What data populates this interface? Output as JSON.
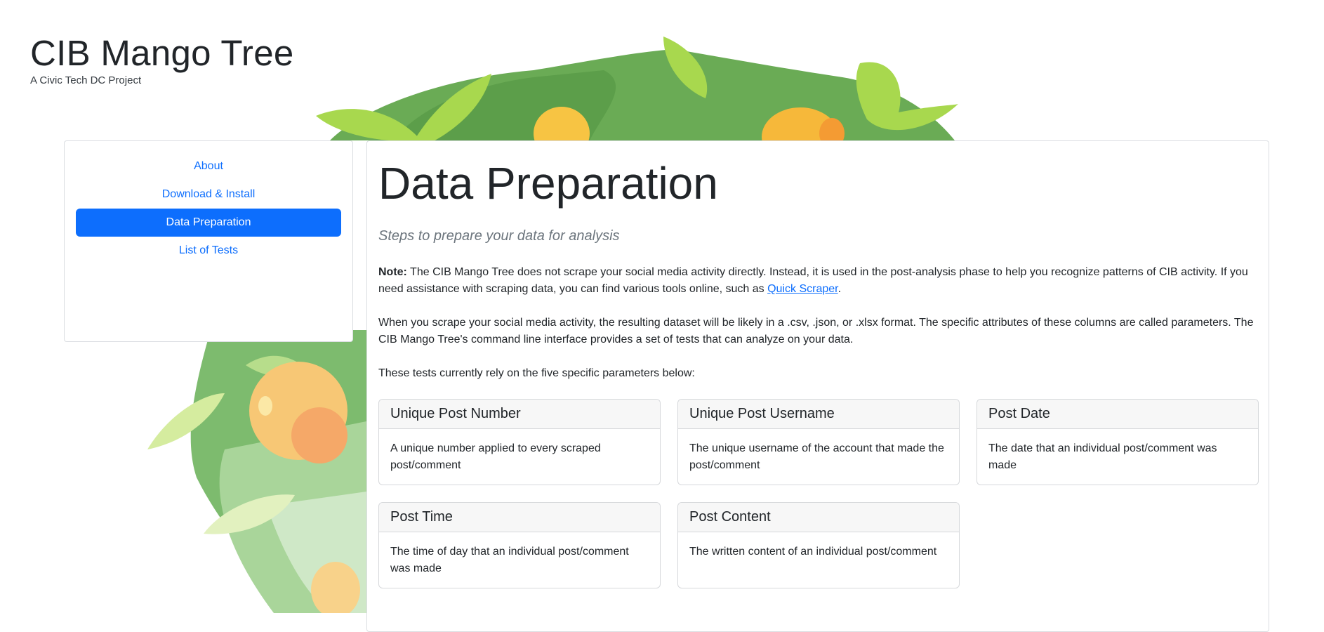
{
  "header": {
    "title": "CIB Mango Tree",
    "subtitle": "A Civic Tech DC Project"
  },
  "sidebar": {
    "items": [
      {
        "label": "About",
        "active": false
      },
      {
        "label": "Download & Install",
        "active": false
      },
      {
        "label": "Data Preparation",
        "active": true
      },
      {
        "label": "List of Tests",
        "active": false
      }
    ]
  },
  "main": {
    "title": "Data Preparation",
    "lead": "Steps to prepare your data for analysis",
    "note_label": "Note:",
    "note_text": "The CIB Mango Tree does not scrape your social media activity directly. Instead, it is used in the post-analysis phase to help you recognize patterns of CIB activity. If you need assistance with scraping data, you can find various tools online, such as",
    "note_link": "Quick Scraper",
    "note_end": ".",
    "paragraph2": "When you scrape your social media activity, the resulting dataset will be likely in a .csv, .json, or .xlsx format. The specific attributes of these columns are called parameters. The CIB Mango Tree's command line interface provides a set of tests that can analyze on your data.",
    "paragraph3": "These tests currently rely on the five specific parameters below:",
    "cards": [
      {
        "title": "Unique Post Number",
        "body": "A unique number applied to every scraped post/comment"
      },
      {
        "title": "Unique Post Username",
        "body": "The unique username of the account that made the post/comment"
      },
      {
        "title": "Post Date",
        "body": "The date that an individual post/comment was made"
      },
      {
        "title": "Post Time",
        "body": "The time of day that an individual post/comment was made"
      },
      {
        "title": "Post Content",
        "body": "The written content of an individual post/comment"
      }
    ]
  },
  "colors": {
    "accent": "#0d6efd",
    "leaf_light": "#a8d84e",
    "leaf_dark": "#2e9a5a",
    "mango": "#f7c443"
  }
}
